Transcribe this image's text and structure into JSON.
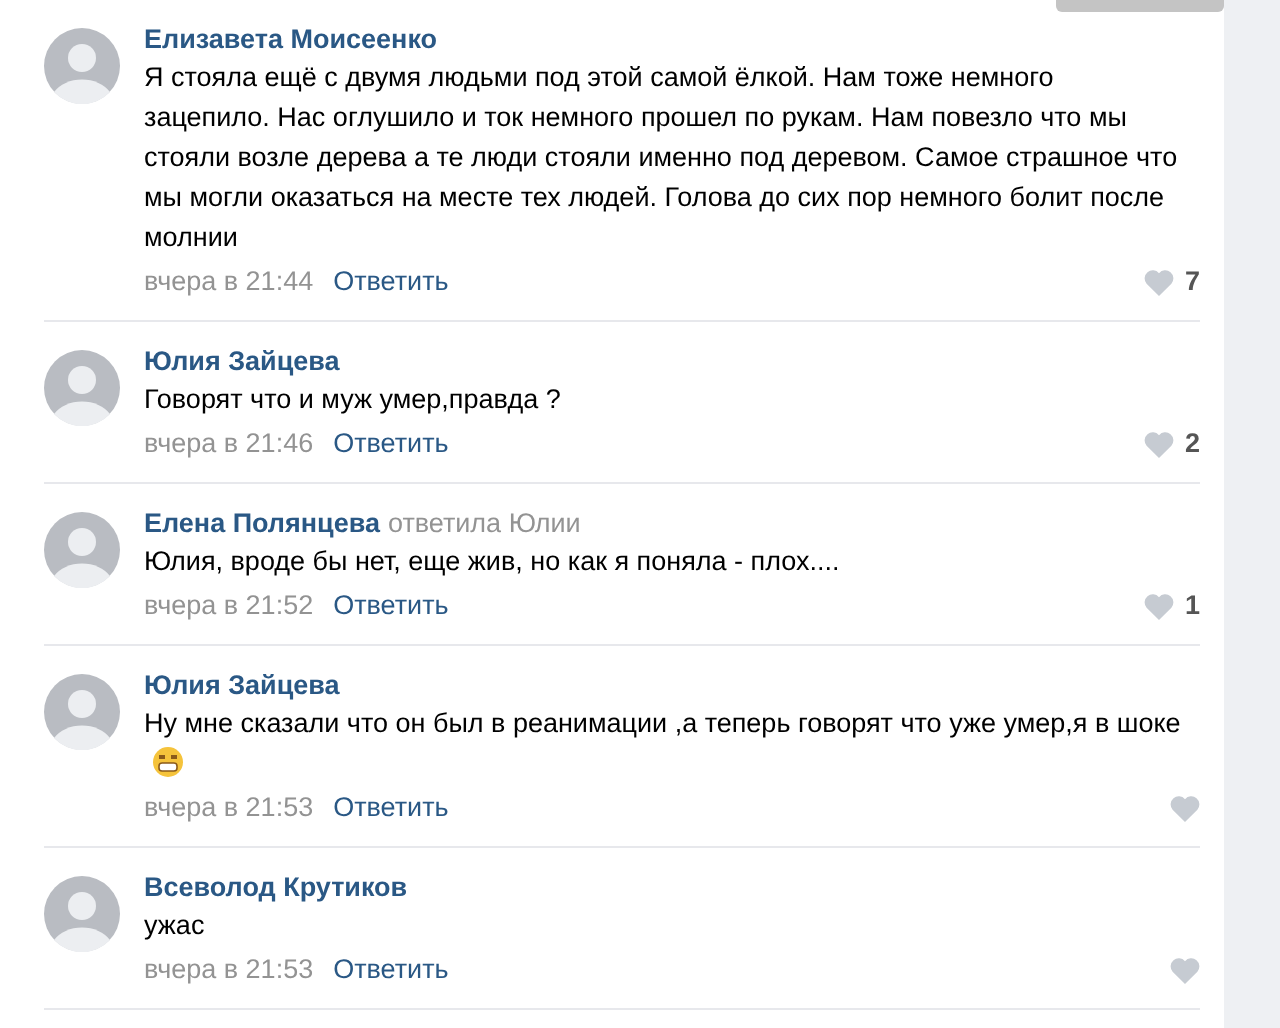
{
  "comments": [
    {
      "author": "Елизавета Моисеенко",
      "text": "Я стояла ещё с двумя людьми под этой самой ёлкой. Нам тоже немного зацепило. Нас оглушило и ток немного прошел по рукам. Нам повезло что мы стояли возле дерева а те люди стояли именно под деревом. Самое страшное что мы могли оказаться на месте тех людей. Голова до сих пор немного болит после молнии",
      "time": "вчера в 21:44",
      "reply": "Ответить",
      "likes": "7"
    },
    {
      "author": "Юлия Зайцева",
      "text": "Говорят что и муж умер,правда ?",
      "time": "вчера в 21:46",
      "reply": "Ответить",
      "likes": "2"
    },
    {
      "author": "Елена Полянцева",
      "reply_to": "ответила Юлии",
      "text": "Юлия, вроде бы нет, еще жив, но как я поняла - плох....",
      "time": "вчера в 21:52",
      "reply": "Ответить",
      "likes": "1"
    },
    {
      "author": "Юлия Зайцева",
      "text": "Ну мне сказали что он был в реанимации ,а теперь говорят что уже умер,я в шоке",
      "emoji": true,
      "time": "вчера в 21:53",
      "reply": "Ответить"
    },
    {
      "author": "Всеволод Крутиков",
      "text": "ужас",
      "time": "вчера в 21:53",
      "reply": "Ответить"
    }
  ]
}
